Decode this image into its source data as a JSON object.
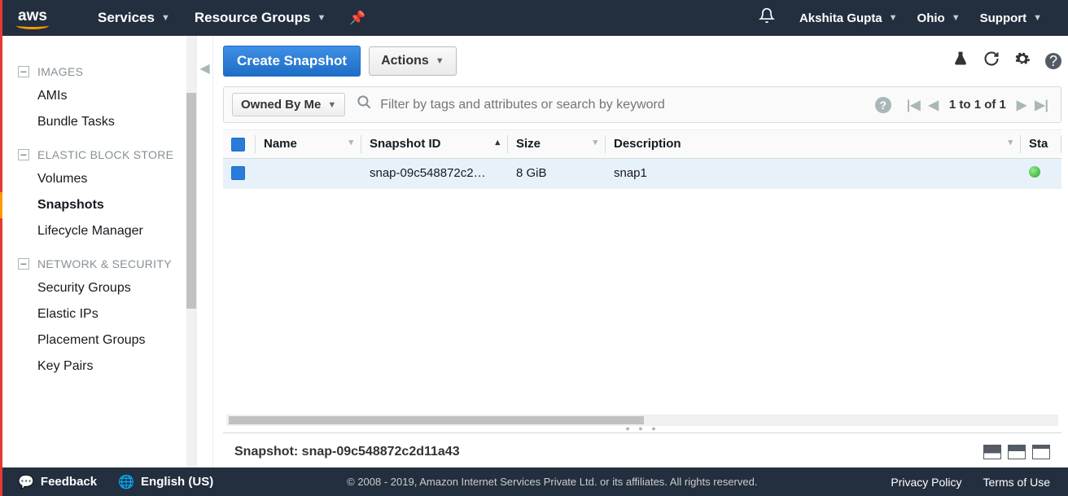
{
  "topnav": {
    "logo": "aws",
    "services": "Services",
    "resource_groups": "Resource Groups",
    "user": "Akshita Gupta",
    "region": "Ohio",
    "support": "Support"
  },
  "sidebar": {
    "sections": [
      {
        "title": "IMAGES",
        "items": [
          "AMIs",
          "Bundle Tasks"
        ]
      },
      {
        "title": "ELASTIC BLOCK STORE",
        "items": [
          "Volumes",
          "Snapshots",
          "Lifecycle Manager"
        ]
      },
      {
        "title": "NETWORK & SECURITY",
        "items": [
          "Security Groups",
          "Elastic IPs",
          "Placement Groups",
          "Key Pairs"
        ]
      }
    ],
    "active": "Snapshots"
  },
  "toolbar": {
    "create_label": "Create Snapshot",
    "actions_label": "Actions"
  },
  "filter": {
    "dropdown": "Owned By Me",
    "placeholder": "Filter by tags and attributes or search by keyword",
    "pager": "1 to 1 of 1"
  },
  "table": {
    "headers": [
      "",
      "Name",
      "Snapshot ID",
      "Size",
      "Description",
      "Sta"
    ],
    "row": {
      "name": "",
      "snapshot_id": "snap-09c548872c2…",
      "size": "8 GiB",
      "description": "snap1"
    }
  },
  "detail": {
    "title": "Snapshot: snap-09c548872c2d11a43"
  },
  "footer": {
    "feedback": "Feedback",
    "language": "English (US)",
    "copyright": "© 2008 - 2019, Amazon Internet Services Private Ltd. or its affiliates. All rights reserved.",
    "privacy": "Privacy Policy",
    "terms": "Terms of Use"
  }
}
